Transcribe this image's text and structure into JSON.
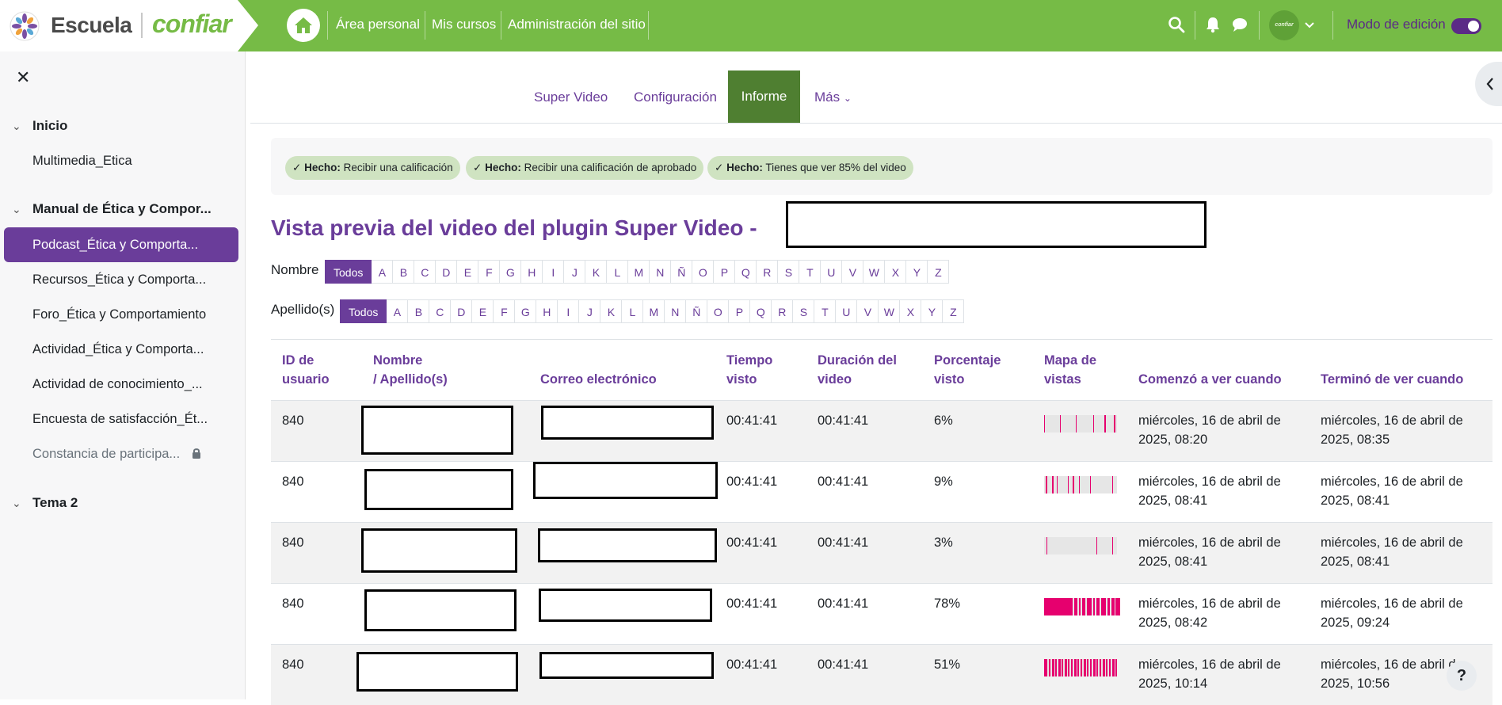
{
  "brand": {
    "escuela": "Escuela",
    "confiar": "confiar",
    "avatar_text": "confiar"
  },
  "topnav": {
    "items": [
      "Área personal",
      "Mis cursos",
      "Administración del sitio"
    ],
    "edit_mode_label": "Modo de edición"
  },
  "sidebar": {
    "close_glyph": "✕",
    "sections": [
      {
        "title": "Inicio",
        "items": [
          {
            "label": "Multimedia_Etica"
          }
        ]
      },
      {
        "title": "Manual de Ética y Compor...",
        "items": [
          {
            "label": "Podcast_Ética y Comporta...",
            "active": true
          },
          {
            "label": "Recursos_Ética y Comporta..."
          },
          {
            "label": "Foro_Ética y Comportamiento"
          },
          {
            "label": "Actividad_Ética y Comporta..."
          },
          {
            "label": "Actividad de conocimiento_..."
          },
          {
            "label": "Encuesta de satisfacción_Ét..."
          },
          {
            "label": "Constancia de participa...",
            "locked": true
          }
        ]
      },
      {
        "title": "Tema 2",
        "items": []
      }
    ]
  },
  "subnav": {
    "tabs": [
      "Super Video",
      "Configuración",
      "Informe",
      "Más"
    ],
    "active": "Informe"
  },
  "completion": [
    {
      "strong": "Hecho:",
      "text": "Recibir una calificación"
    },
    {
      "strong": "Hecho:",
      "text": "Recibir una calificación de aprobado"
    },
    {
      "strong": "Hecho:",
      "text": "Tienes que ver 85% del video"
    }
  ],
  "page_title": "Vista previa del video del plugin Super Video -",
  "filters": {
    "first_label": "Nombre",
    "last_label": "Apellido(s)",
    "all": "Todos",
    "letters": [
      "A",
      "B",
      "C",
      "D",
      "E",
      "F",
      "G",
      "H",
      "I",
      "J",
      "K",
      "L",
      "M",
      "N",
      "Ñ",
      "O",
      "P",
      "Q",
      "R",
      "S",
      "T",
      "U",
      "V",
      "W",
      "X",
      "Y",
      "Z"
    ]
  },
  "table": {
    "headers": {
      "id": [
        "ID de",
        "usuario"
      ],
      "name": [
        "Nombre",
        "/ Apellido(s)"
      ],
      "email": "Correo electrónico",
      "time": [
        "Tiempo",
        "visto"
      ],
      "duration": [
        "Duración del",
        "video"
      ],
      "percent": [
        "Porcentaje",
        "visto"
      ],
      "map": [
        "Mapa de",
        "vistas"
      ],
      "start": "Comenzó a ver cuando",
      "end": "Terminó de ver cuando"
    },
    "rows": [
      {
        "id": "840",
        "time": "00:41:41",
        "duration": "00:41:41",
        "percent": "6%",
        "start1": "miércoles, 16 de abril de",
        "start2": "2025, 08:20",
        "end1": "miércoles, 16 de abril de",
        "end2": "2025, 08:35"
      },
      {
        "id": "840",
        "time": "00:41:41",
        "duration": "00:41:41",
        "percent": "9%",
        "start1": "miércoles, 16 de abril de",
        "start2": "2025, 08:41",
        "end1": "miércoles, 16 de abril de",
        "end2": "2025, 08:41"
      },
      {
        "id": "840",
        "time": "00:41:41",
        "duration": "00:41:41",
        "percent": "3%",
        "start1": "miércoles, 16 de abril de",
        "start2": "2025, 08:41",
        "end1": "miércoles, 16 de abril de",
        "end2": "2025, 08:41"
      },
      {
        "id": "840",
        "time": "00:41:41",
        "duration": "00:41:41",
        "percent": "78%",
        "start1": "miércoles, 16 de abril de",
        "start2": "2025, 08:42",
        "end1": "miércoles, 16 de abril de",
        "end2": "2025, 09:24"
      },
      {
        "id": "840",
        "time": "00:41:41",
        "duration": "00:41:41",
        "percent": "51%",
        "start1": "miércoles, 16 de abril de",
        "start2": "2025, 10:14",
        "end1": "miércoles, 16 de abril de",
        "end2": "2025, 10:56"
      }
    ]
  },
  "help": "?",
  "colors": {
    "brand_green": "#76bb46",
    "purple": "#6a3d9a",
    "active_tab": "#4f7f31",
    "heatmap": "#e6006e"
  }
}
